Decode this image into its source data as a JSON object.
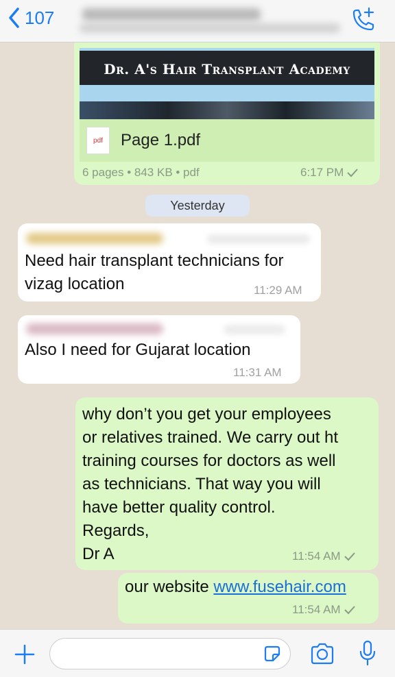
{
  "header": {
    "back_count": "107",
    "accent": "#1b7cf6"
  },
  "messages": {
    "pdf": {
      "banner": "Dr. A's Hair Transplant Academy",
      "file_icon_label": "pdf",
      "filename": "Page 1.pdf",
      "info": "6 pages • 843 KB • pdf",
      "time": "6:17 PM"
    },
    "date_separator": "Yesterday",
    "in1": {
      "text": "Need hair transplant technicians for\nvizag location",
      "time": "11:29 AM"
    },
    "in2": {
      "text": "Also I need for Gujarat location",
      "time": "11:31 AM"
    },
    "out1": {
      "text": "why don’t you get your employees\nor relatives trained. We carry out ht\ntraining courses for doctors as well\nas technicians. That way you will\nhave better quality control.\nRegards,\nDr A",
      "time": "11:54 AM"
    },
    "out2": {
      "prefix": "our website ",
      "link": "www.fusehair.com",
      "time": "11:54 AM"
    }
  },
  "colors": {
    "outgoing_bubble": "#dcf8c6",
    "incoming_bubble": "#ffffff",
    "link": "#1a6ed8"
  }
}
